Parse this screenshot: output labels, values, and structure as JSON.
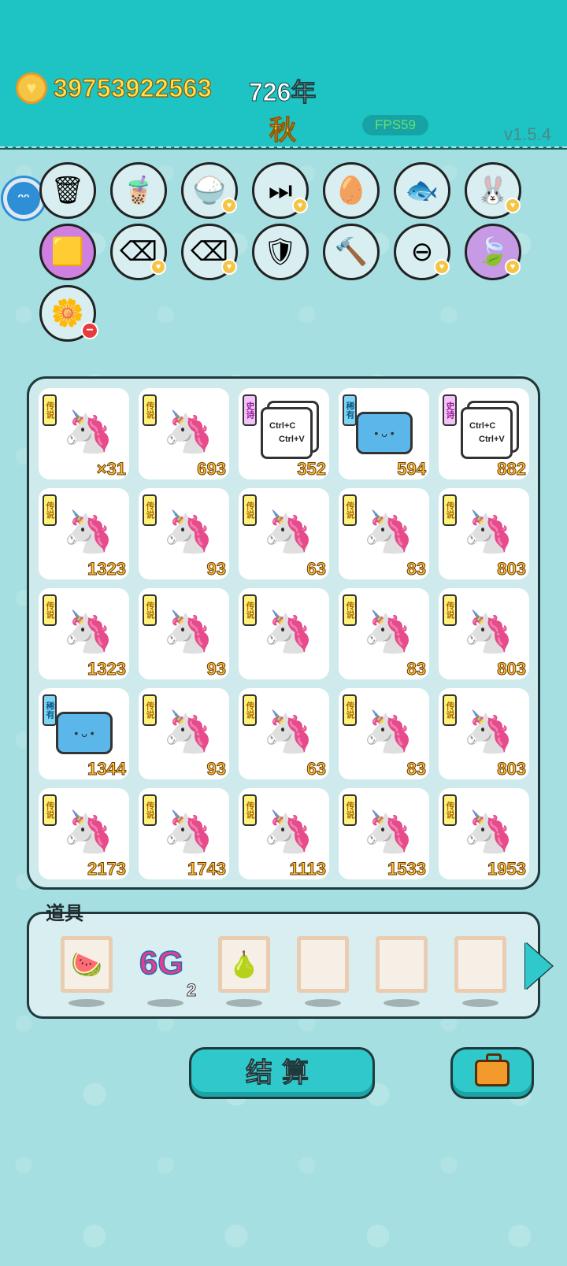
{
  "header": {
    "coin_amount": "39753922563",
    "year": "726年",
    "season": "秋",
    "fps": "FPS59",
    "version": "v1.5.4"
  },
  "items_bar": {
    "row1": [
      {
        "name": "trash-bag",
        "glyph": "🗑"
      },
      {
        "name": "milk-tea",
        "glyph": "🧋"
      },
      {
        "name": "rice-bowl",
        "glyph": "🍚"
      },
      {
        "name": "next-track",
        "glyph": "⏭"
      },
      {
        "name": "egg-tray",
        "glyph": "🥚"
      },
      {
        "name": "fish-tank",
        "glyph": "🐟"
      },
      {
        "name": "bunny",
        "glyph": "🐰"
      }
    ],
    "row2": [
      {
        "name": "pikachu-box",
        "glyph": "🟨"
      },
      {
        "name": "delete-key",
        "glyph": "⌫"
      },
      {
        "name": "delete-key",
        "glyph": "⌫"
      },
      {
        "name": "shield-wrench",
        "glyph": "🛡"
      },
      {
        "name": "hammer",
        "glyph": "🔨"
      },
      {
        "name": "minus-sign",
        "glyph": "⊖"
      },
      {
        "name": "leaf",
        "glyph": "🍃"
      }
    ],
    "row3": [
      {
        "name": "flower-pot",
        "glyph": "🌼"
      }
    ]
  },
  "grid": {
    "cells": [
      {
        "tag": "传说",
        "tag_type": "legend",
        "art": "unicorn",
        "count": "×31"
      },
      {
        "tag": "传说",
        "tag_type": "legend",
        "art": "unicorn",
        "count": "693"
      },
      {
        "tag": "史诗",
        "tag_type": "epic",
        "art": "keys",
        "count": "352"
      },
      {
        "tag": "稀有",
        "tag_type": "rare",
        "art": "printer",
        "count": "594"
      },
      {
        "tag": "史诗",
        "tag_type": "epic",
        "art": "keys",
        "count": "882"
      },
      {
        "tag": "传说",
        "tag_type": "legend",
        "art": "unicorn",
        "count": "1323"
      },
      {
        "tag": "传说",
        "tag_type": "legend",
        "art": "unicorn",
        "count": "93"
      },
      {
        "tag": "传说",
        "tag_type": "legend",
        "art": "unicorn",
        "count": "63"
      },
      {
        "tag": "传说",
        "tag_type": "legend",
        "art": "unicorn",
        "count": "83"
      },
      {
        "tag": "传说",
        "tag_type": "legend",
        "art": "unicorn",
        "count": "803"
      },
      {
        "tag": "传说",
        "tag_type": "legend",
        "art": "unicorn",
        "count": "1323"
      },
      {
        "tag": "传说",
        "tag_type": "legend",
        "art": "unicorn",
        "count": "93"
      },
      {
        "tag": "传说",
        "tag_type": "legend",
        "art": "unicorn",
        "count": ""
      },
      {
        "tag": "传说",
        "tag_type": "legend",
        "art": "unicorn",
        "count": "83"
      },
      {
        "tag": "传说",
        "tag_type": "legend",
        "art": "unicorn",
        "count": "803"
      },
      {
        "tag": "稀有",
        "tag_type": "rare",
        "art": "printer",
        "count": "1344"
      },
      {
        "tag": "传说",
        "tag_type": "legend",
        "art": "unicorn",
        "count": "93"
      },
      {
        "tag": "传说",
        "tag_type": "legend",
        "art": "unicorn",
        "count": "63"
      },
      {
        "tag": "传说",
        "tag_type": "legend",
        "art": "unicorn",
        "count": "83"
      },
      {
        "tag": "传说",
        "tag_type": "legend",
        "art": "unicorn",
        "count": "803"
      },
      {
        "tag": "传说",
        "tag_type": "legend",
        "art": "unicorn",
        "count": "2173"
      },
      {
        "tag": "传说",
        "tag_type": "legend",
        "art": "unicorn",
        "count": "1743"
      },
      {
        "tag": "传说",
        "tag_type": "legend",
        "art": "unicorn",
        "count": "1113"
      },
      {
        "tag": "传说",
        "tag_type": "legend",
        "art": "unicorn",
        "count": "1533"
      },
      {
        "tag": "传说",
        "tag_type": "legend",
        "art": "unicorn",
        "count": "1953"
      }
    ],
    "key_text_1": "Ctrl+C",
    "key_text_2": "Ctrl+V"
  },
  "tools": {
    "label": "道具",
    "tool_6g": "6G",
    "tool_6g_count": "2"
  },
  "buttons": {
    "settle": "结算"
  }
}
